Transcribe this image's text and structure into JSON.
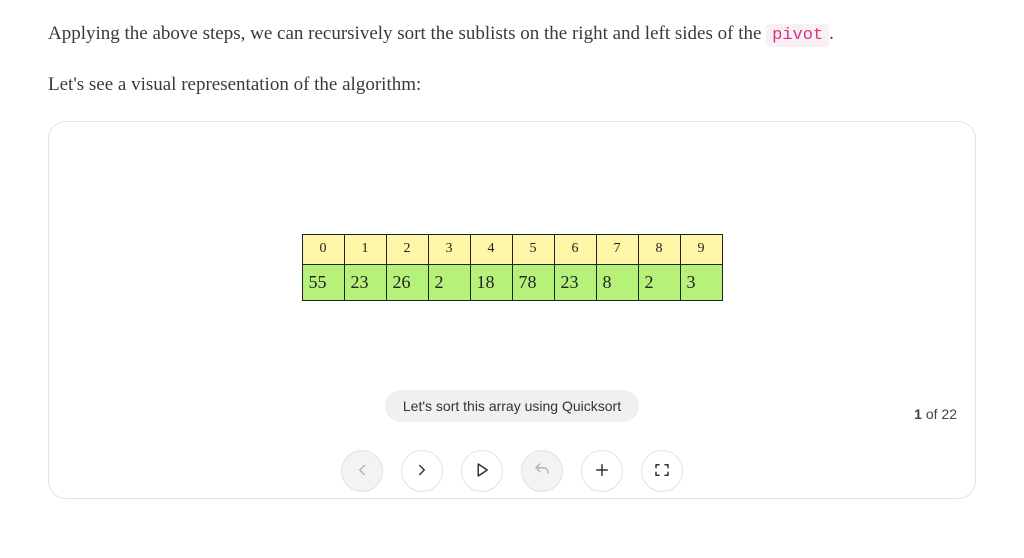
{
  "paragraphs": {
    "p1_pre": "Applying the above steps, we can recursively sort the sublists on the right and left sides of the ",
    "p1_code": "pivot",
    "p1_post": ".",
    "p2": "Let's see a visual representation of the algorithm:"
  },
  "chart_data": {
    "type": "table",
    "indices": [
      0,
      1,
      2,
      3,
      4,
      5,
      6,
      7,
      8,
      9
    ],
    "values": [
      55,
      23,
      26,
      2,
      18,
      78,
      23,
      8,
      2,
      3
    ]
  },
  "viz": {
    "caption": "Let's sort this array using Quicksort",
    "pager_current": "1",
    "pager_of": " of ",
    "pager_total": "22"
  },
  "controls": {
    "prev": "Previous",
    "next": "Next",
    "play": "Play",
    "restart": "Restart",
    "zoom": "Zoom",
    "fullscreen": "Fullscreen"
  }
}
